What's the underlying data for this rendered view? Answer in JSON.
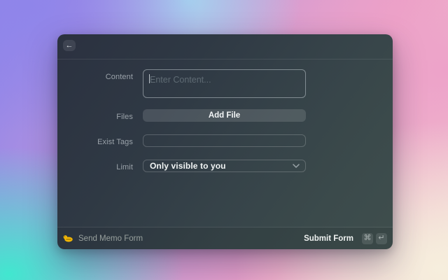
{
  "header": {
    "back_icon": "←"
  },
  "form": {
    "content": {
      "label": "Content",
      "placeholder": "Enter Content..."
    },
    "files": {
      "label": "Files",
      "button_label": "Add File"
    },
    "exist_tags": {
      "label": "Exist Tags",
      "value": ""
    },
    "limit": {
      "label": "Limit",
      "value": "Only visible to you"
    }
  },
  "footer": {
    "app_icon": "memo-duck-icon",
    "title": "Send Memo Form",
    "submit": {
      "label": "Submit Form",
      "keys": [
        "⌘",
        "↵"
      ]
    }
  },
  "colors": {
    "app_icon_yellow": "#F2B606",
    "bg_purple": "#8F85EA",
    "bg_lightblue": "#A6D2EE",
    "bg_pink": "#EDA2C9",
    "bg_teal": "#41E7CF",
    "bg_cream": "#F6EEDD",
    "panel_dark": "#2B3140",
    "panel_green": "#3E4D4C"
  }
}
